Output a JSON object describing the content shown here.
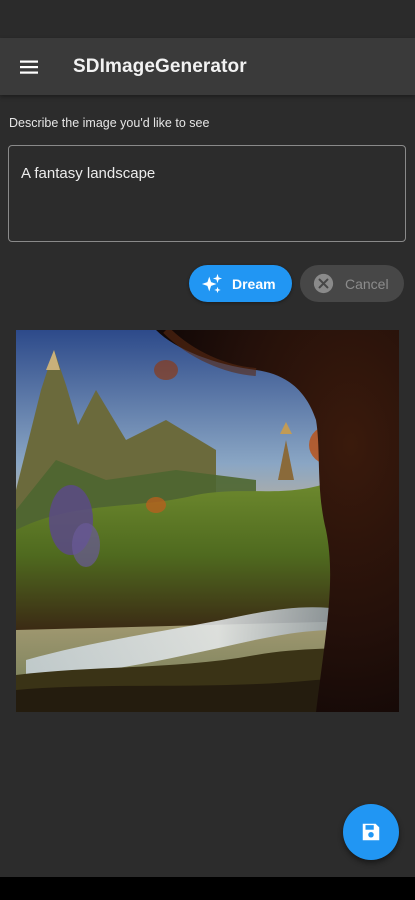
{
  "app_bar": {
    "title": "SDImageGenerator",
    "menu_icon": "menu-icon"
  },
  "prompt": {
    "label": "Describe the image you'd like to see",
    "value": "A fantasy landscape"
  },
  "actions": {
    "dream_label": "Dream",
    "dream_icon": "sparkles-icon",
    "cancel_label": "Cancel",
    "cancel_icon": "cancel-circle-icon",
    "cancel_enabled": false
  },
  "fab": {
    "icon": "save-icon"
  },
  "colors": {
    "background": "#2c2c2c",
    "app_bar": "#3a3a3a",
    "accent": "#2196f3",
    "disabled_button": "#474747"
  }
}
